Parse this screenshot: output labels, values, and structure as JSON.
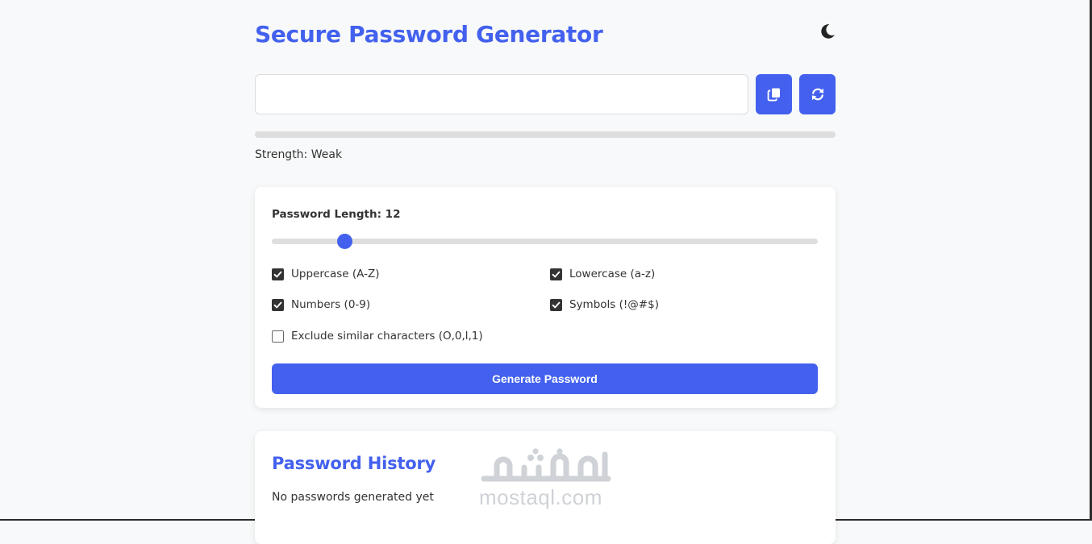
{
  "app": {
    "title": "Secure Password Generator",
    "theme_icon": "moon-icon"
  },
  "output": {
    "password_value": "",
    "copy_icon": "copy-icon",
    "refresh_icon": "refresh-icon"
  },
  "strength": {
    "label": "Strength: Weak",
    "level_fraction": 0
  },
  "settings": {
    "length_label": "Password Length: 12",
    "length_value": 12,
    "length_min": 4,
    "length_max": 64,
    "options": {
      "uppercase": {
        "label": "Uppercase (A-Z)",
        "checked": true
      },
      "lowercase": {
        "label": "Lowercase (a-z)",
        "checked": true
      },
      "numbers": {
        "label": "Numbers (0-9)",
        "checked": true
      },
      "symbols": {
        "label": "Symbols (!@#$)",
        "checked": true
      },
      "exclude_similar": {
        "label": "Exclude similar characters (O,0,l,1)",
        "checked": false
      }
    },
    "generate_label": "Generate Password"
  },
  "history": {
    "title": "Password History",
    "empty_text": "No passwords generated yet"
  },
  "watermark": {
    "text": "mostaql.com"
  },
  "colors": {
    "accent": "#4361ee",
    "background": "#f8f9fa",
    "text": "#333333",
    "track": "#dedede"
  }
}
